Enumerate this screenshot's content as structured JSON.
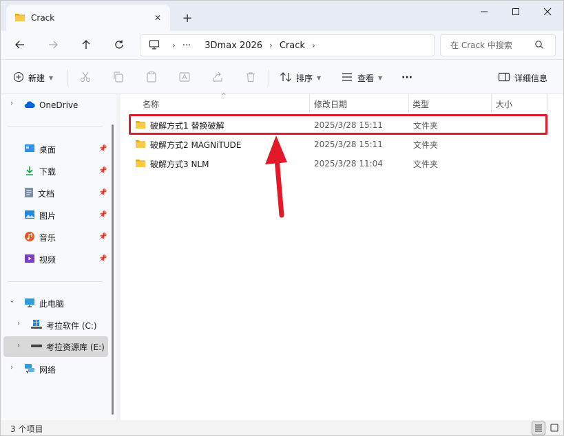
{
  "window": {
    "tab_title": "Crack",
    "new_tab_symbol": "+",
    "close_tab_symbol": "✕",
    "minimize_symbol": "—",
    "maximize_symbol": "☐",
    "close_symbol": "✕"
  },
  "address": {
    "crumbs": [
      "···",
      "3Dmax 2026",
      "Crack"
    ],
    "search_placeholder": "在 Crack 中搜索"
  },
  "toolbar": {
    "new_label": "新建",
    "sort_label": "排序",
    "view_label": "查看",
    "more_label": "···",
    "details_label": "详细信息"
  },
  "sidebar": {
    "onedrive": "OneDrive",
    "quick": [
      "桌面",
      "下载",
      "文档",
      "图片",
      "音乐",
      "视频"
    ],
    "this_pc": "此电脑",
    "drives": [
      "考拉软件 (C:)",
      "考拉资源库 (E:)"
    ],
    "network": "网络"
  },
  "columns": {
    "name": "名称",
    "modified": "修改日期",
    "type": "类型",
    "size": "大小"
  },
  "files": [
    {
      "name": "破解方式1 替换破解",
      "modified": "2025/3/28 15:11",
      "type": "文件夹"
    },
    {
      "name": "破解方式2 MAGNiTUDE",
      "modified": "2025/3/28 15:11",
      "type": "文件夹"
    },
    {
      "name": "破解方式3 NLM",
      "modified": "2025/3/28 11:04",
      "type": "文件夹"
    }
  ],
  "status": {
    "item_count": "3 个项目"
  },
  "colors": {
    "highlight": "#e5182a",
    "folder": "#f4c430",
    "accent": "#0067c0"
  }
}
